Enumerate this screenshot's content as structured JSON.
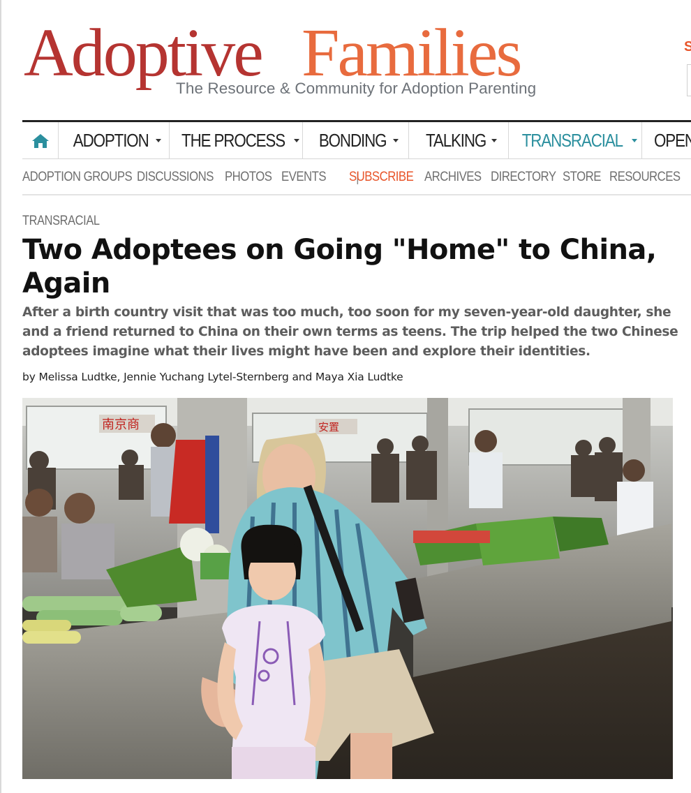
{
  "brand": {
    "name_part1": "Adoptive",
    "name_part2": "Families",
    "tagline": "The Resource & Community for Adoption Parenting",
    "primary_color": "#b53431",
    "accent_color": "#e86b3e"
  },
  "header_edge": {
    "cut_letter": "S"
  },
  "main_nav": {
    "home_icon": "home-icon",
    "items": [
      {
        "label": "ADOPTION",
        "active": false
      },
      {
        "label": "THE PROCESS",
        "active": false
      },
      {
        "label": "BONDING",
        "active": false
      },
      {
        "label": "TALKING",
        "active": false
      },
      {
        "label": "TRANSRACIAL",
        "active": true
      },
      {
        "label": "OPEN",
        "active": false
      }
    ],
    "active_color": "#2b8f9e"
  },
  "sub_nav": {
    "items": [
      "ADOPTION GROUPS",
      "DISCUSSIONS",
      "PHOTOS",
      "EVENTS"
    ],
    "separator": "|",
    "subscribe": "SUBSCRIBE",
    "items_after": [
      "ARCHIVES",
      "DIRECTORY",
      "STORE",
      "RESOURCES"
    ],
    "subscribe_color": "#e8552a"
  },
  "article": {
    "category": "TRANSRACIAL",
    "title": "Two Adoptees on Going \"Home\" to China, Again",
    "dek": "After a birth country visit that was too much, too soon for my seven-year-old daughter, she and a friend returned to China on their own terms as teens. The trip helped the two Chinese adoptees imagine what their lives might have been and explore their identities.",
    "byline": "by Melissa Ludtke, Jennie Yuchang Lytel-Sternberg and Maya Xia Ludtke",
    "photo": {
      "sign_text": "南京商",
      "sign_text_2": "安置"
    }
  }
}
